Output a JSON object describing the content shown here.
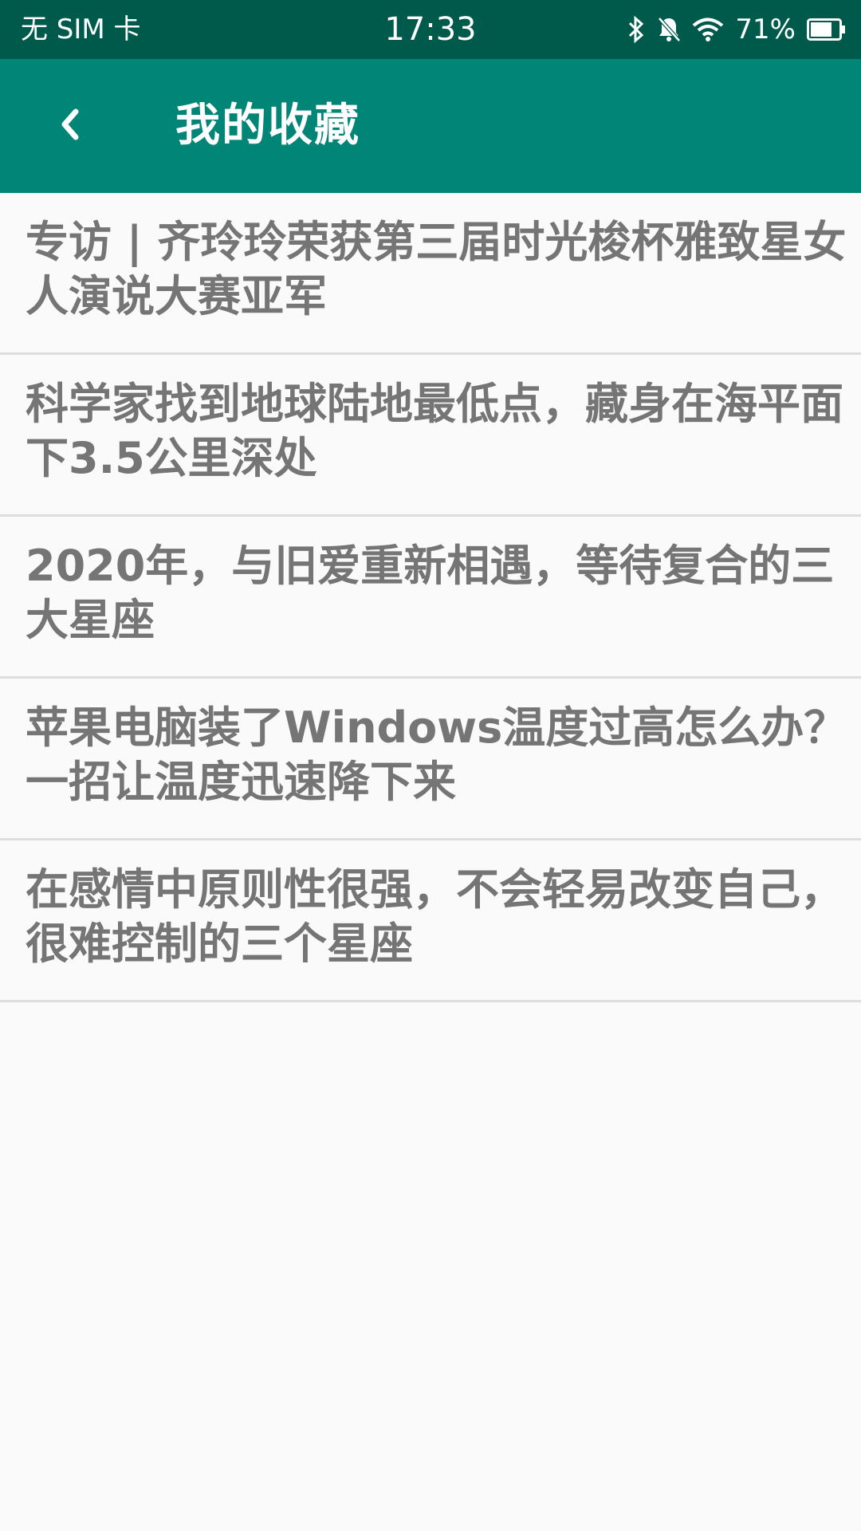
{
  "status_bar": {
    "carrier": "无 SIM 卡",
    "time": "17:33",
    "battery": "71%",
    "icons": [
      "bluetooth-icon",
      "bell-off-icon",
      "wifi-icon",
      "battery-icon"
    ]
  },
  "app_bar": {
    "back_icon": "chevron-left-icon",
    "title": "我的收藏",
    "color": "#008577"
  },
  "favorites": [
    {
      "title": "专访 | 齐玲玲荣获第三届时光梭杯雅致星女人演说大赛亚军"
    },
    {
      "title": "科学家找到地球陆地最低点，藏身在海平面下3.5公里深处"
    },
    {
      "title": "2020年，与旧爱重新相遇，等待复合的三大星座"
    },
    {
      "title": "苹果电脑装了Windows温度过高怎么办？一招让温度迅速降下来"
    },
    {
      "title": "在感情中原则性很强，不会轻易改变自己，很难控制的三个星座"
    }
  ]
}
